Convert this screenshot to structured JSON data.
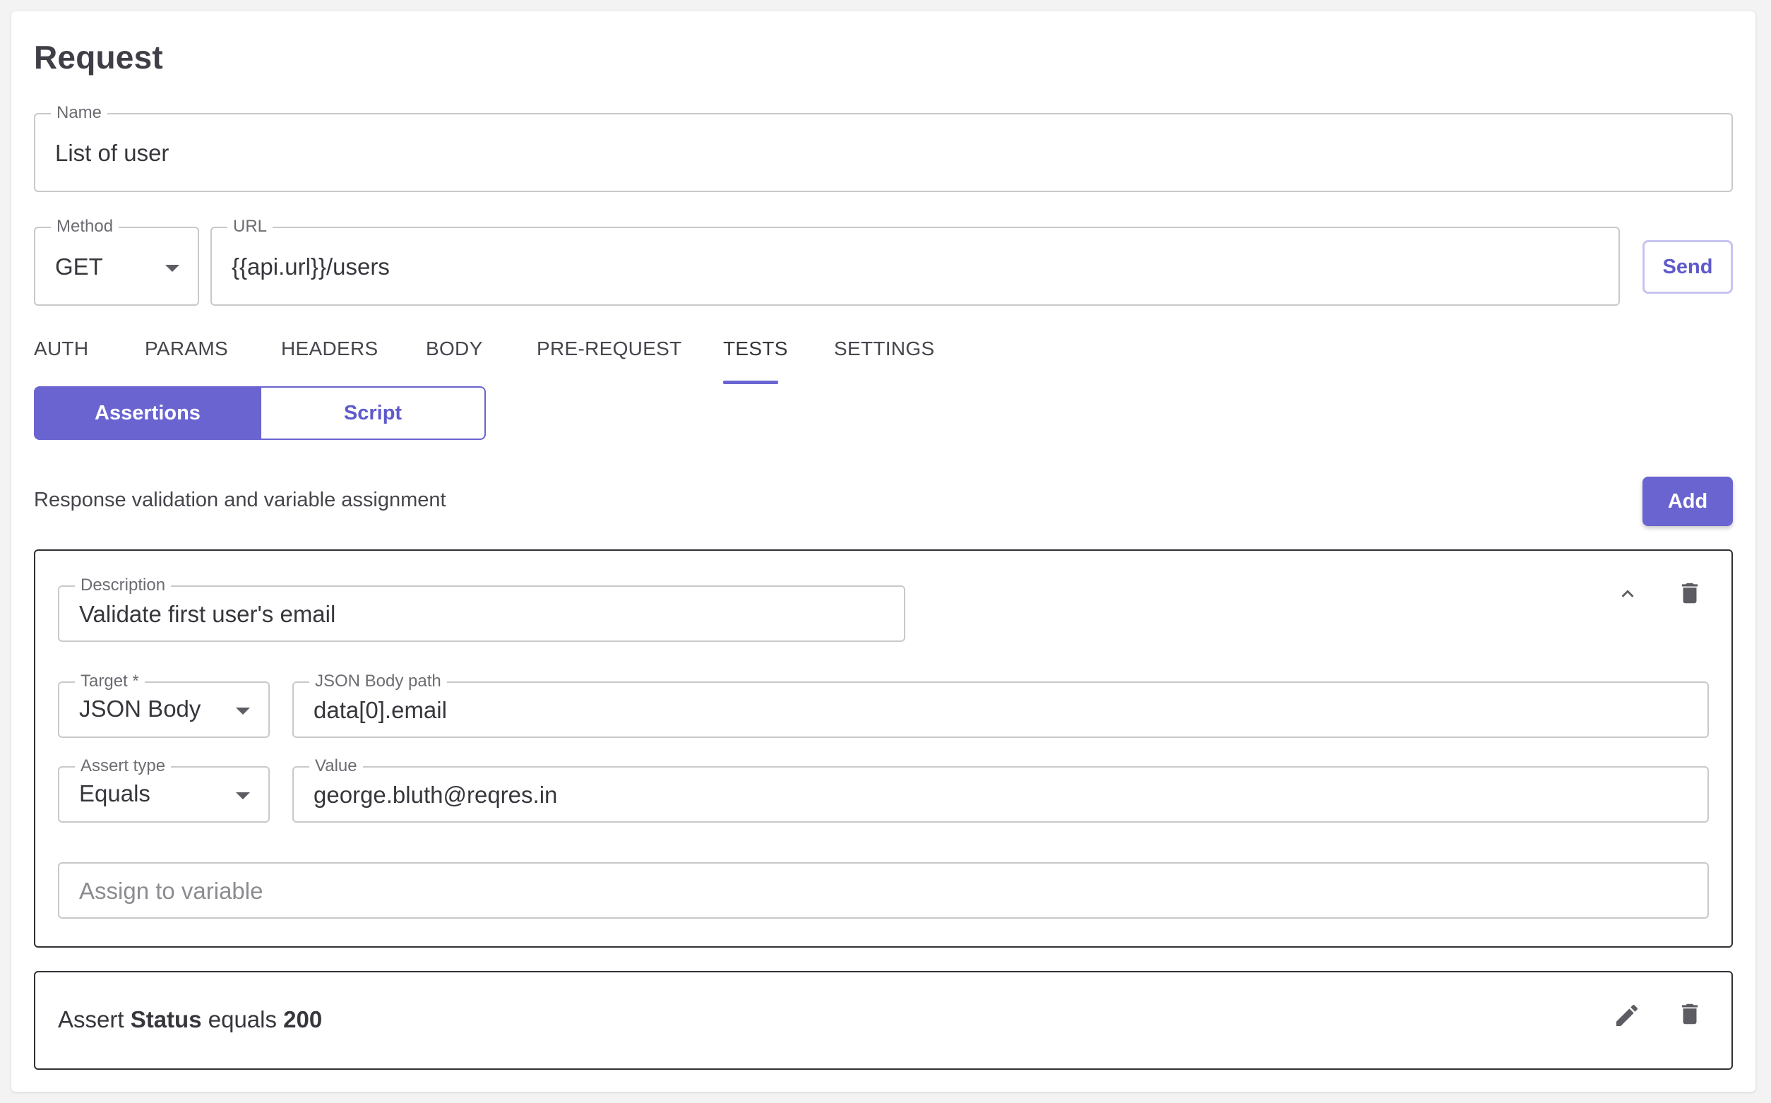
{
  "header": {
    "title": "Request"
  },
  "name_field": {
    "label": "Name",
    "value": "List of user"
  },
  "method_field": {
    "label": "Method",
    "value": "GET"
  },
  "url_field": {
    "label": "URL",
    "value": "{{api.url}}/users"
  },
  "send_label": "Send",
  "tabs": [
    {
      "label": "AUTH",
      "active": false
    },
    {
      "label": "PARAMS",
      "active": false
    },
    {
      "label": "HEADERS",
      "active": false
    },
    {
      "label": "BODY",
      "active": false
    },
    {
      "label": "PRE-REQUEST",
      "active": false
    },
    {
      "label": "TESTS",
      "active": true
    },
    {
      "label": "SETTINGS",
      "active": false
    }
  ],
  "segment": {
    "assertions_label": "Assertions",
    "script_label": "Script",
    "selected": "Assertions"
  },
  "section": {
    "subtitle": "Response validation and variable assignment",
    "add_label": "Add"
  },
  "assertion_editor": {
    "description": {
      "label": "Description",
      "value": "Validate first user's email"
    },
    "target": {
      "label": "Target *",
      "value": "JSON Body"
    },
    "json_path": {
      "label": "JSON Body path",
      "value": "data[0].email"
    },
    "assert_type": {
      "label": "Assert type",
      "value": "Equals"
    },
    "value": {
      "label": "Value",
      "value": "george.bluth@reqres.in"
    },
    "assign_placeholder": "Assign to variable",
    "icons": [
      "chevron-up-icon",
      "delete-icon"
    ]
  },
  "assertion_summary": {
    "prefix": "Assert",
    "target": "Status",
    "operator": "equals",
    "expected": "200",
    "icons": [
      "edit-icon",
      "delete-icon"
    ]
  },
  "colors": {
    "accent": "#6a64d0",
    "accent_text": "#5f5acb",
    "border": "#c9c9cc",
    "panel_border": "#303035"
  }
}
